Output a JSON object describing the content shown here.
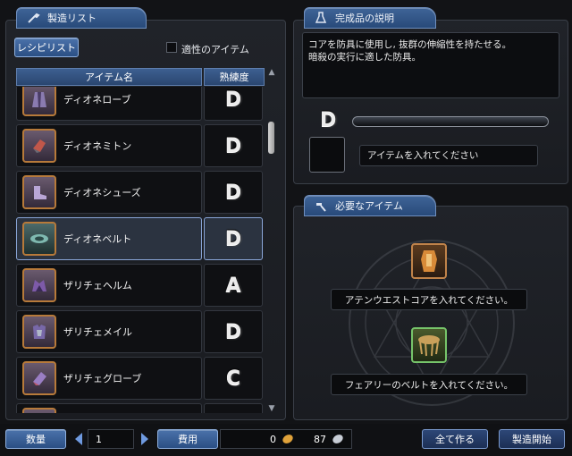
{
  "left_panel": {
    "tab_title": "製造リスト",
    "recipe_button": "レシピリスト",
    "filter_label": "適性のアイテム",
    "columns": {
      "item_name": "アイテム名",
      "proficiency": "熟練度"
    },
    "items": [
      {
        "name": "ディオネローブ",
        "grade": "D"
      },
      {
        "name": "ディオネミトン",
        "grade": "D"
      },
      {
        "name": "ディオネシューズ",
        "grade": "D"
      },
      {
        "name": "ディオネベルト",
        "grade": "D",
        "selected": true
      },
      {
        "name": "ザリチェヘルム",
        "grade": "A"
      },
      {
        "name": "ザリチェメイル",
        "grade": "D"
      },
      {
        "name": "ザリチェグローブ",
        "grade": "C"
      }
    ]
  },
  "right_panel": {
    "desc_tab_title": "完成品の説明",
    "description_line1": "コアを防具に使用し, 抜群の伸縮性を持たせる。",
    "description_line2": "暗殺の実行に適した防具。",
    "result_grade": "D",
    "result_slot_text": "アイテムを入れてください",
    "required_tab_title": "必要なアイテム",
    "required": [
      {
        "text": "アテンウエストコアを入れてください。"
      },
      {
        "text": "フェアリーのベルトを入れてください。"
      }
    ]
  },
  "bottom_bar": {
    "quantity_label": "数量",
    "quantity_value": "1",
    "cost_label": "費用",
    "cost_gold": "0",
    "cost_crystal": "87",
    "make_all_label": "全て作る",
    "start_label": "製造開始"
  },
  "colors": {
    "tab_blue": "#3f6497",
    "selected_border": "#8aa6d8",
    "slot_orange": "#c0834a",
    "slot_green": "#76c46a"
  }
}
